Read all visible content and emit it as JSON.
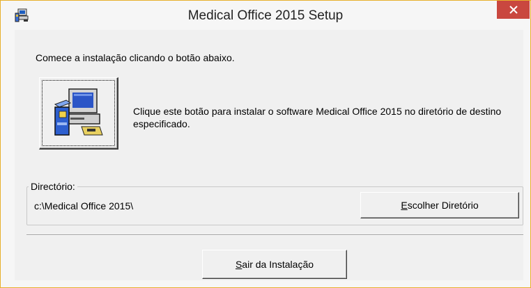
{
  "window": {
    "title": "Medical Office 2015 Setup",
    "icon": "setup-computer-icon",
    "close_icon": "close-icon",
    "accent_color": "#c9473f"
  },
  "main": {
    "intro_text": "Comece a instalação clicando o botão abaixo.",
    "install_button_icon": "computer-setup-icon",
    "install_description": "Clique este botão para instalar o software Medical Office 2015 no diretório de destino especificado."
  },
  "directory": {
    "group_label": "Directório:",
    "path": "c:\\Medical Office 2015\\",
    "choose_button": {
      "mnemonic": "E",
      "rest": "scolher Diretório"
    }
  },
  "footer": {
    "exit_button": {
      "mnemonic": "S",
      "rest": "air da Instalação"
    }
  }
}
